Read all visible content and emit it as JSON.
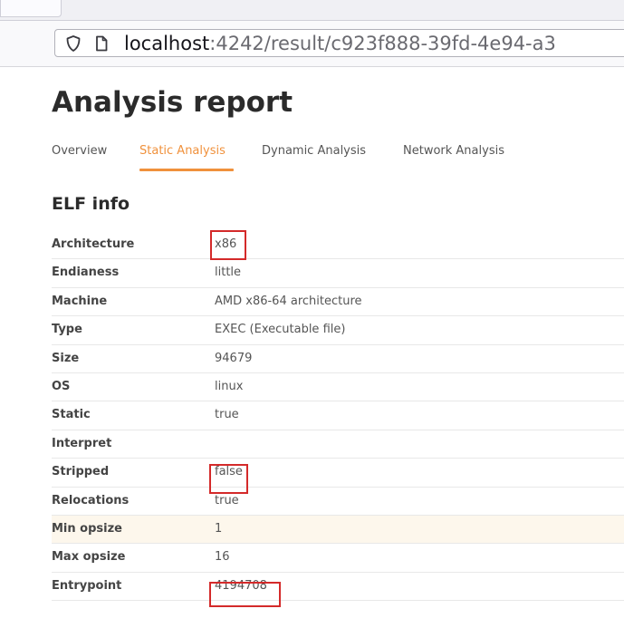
{
  "browser": {
    "url_host": "localhost",
    "url_rest": ":4242/result/c923f888-39fd-4e94-a3",
    "icons": [
      "shield-icon",
      "page-icon"
    ]
  },
  "page": {
    "title": "Analysis report",
    "tabs": [
      {
        "label": "Overview",
        "active": false
      },
      {
        "label": "Static Analysis",
        "active": true
      },
      {
        "label": "Dynamic Analysis",
        "active": false
      },
      {
        "label": "Network Analysis",
        "active": false
      }
    ],
    "accent_color": "#f0913c",
    "highlight_color": "#d42a2a"
  },
  "elf_info": {
    "section_title": "ELF info",
    "rows": [
      {
        "key": "Architecture",
        "value": "x86"
      },
      {
        "key": "Endianess",
        "value": "little"
      },
      {
        "key": "Machine",
        "value": "AMD x86-64 architecture"
      },
      {
        "key": "Type",
        "value": "EXEC (Executable file)"
      },
      {
        "key": "Size",
        "value": "94679"
      },
      {
        "key": "OS",
        "value": "linux"
      },
      {
        "key": "Static",
        "value": "true"
      },
      {
        "key": "Interpret",
        "value": ""
      },
      {
        "key": "Stripped",
        "value": "false"
      },
      {
        "key": "Relocations",
        "value": "true"
      },
      {
        "key": "Min opsize",
        "value": "1"
      },
      {
        "key": "Max opsize",
        "value": "16"
      },
      {
        "key": "Entrypoint",
        "value": "4194708"
      }
    ],
    "highlighted_row": "Min opsize",
    "marked_values": [
      "Architecture",
      "Stripped",
      "Entrypoint"
    ]
  }
}
